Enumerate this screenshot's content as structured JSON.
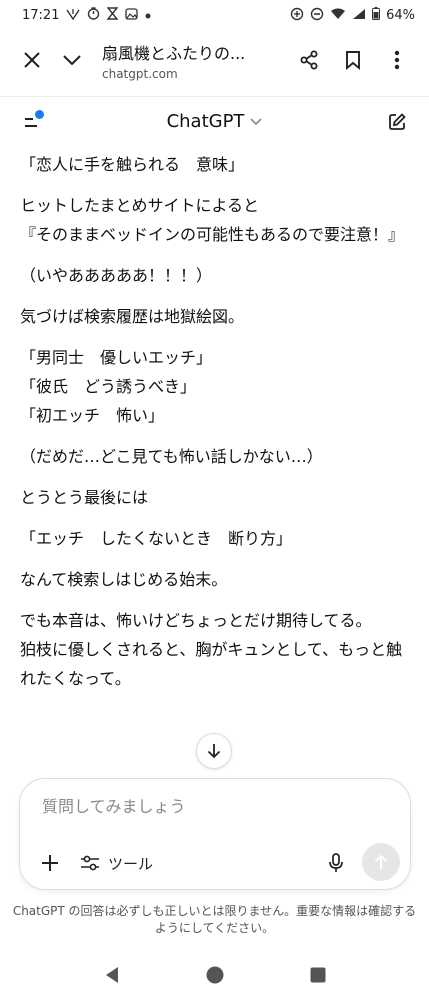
{
  "status_bar": {
    "time": "17:21",
    "battery": "64%"
  },
  "browser": {
    "title": "扇風機とふたりの...",
    "url": "chatgpt.com"
  },
  "app": {
    "title": "ChatGPT"
  },
  "messages": [
    "「恋人に手を触られる　意味」",
    "ヒットしたまとめサイトによると\n『そのままベッドインの可能性もあるので要注意！』",
    "（いやあああああ！！！）",
    "気づけば検索履歴は地獄絵図。",
    "「男同士　優しいエッチ」\n「彼氏　どう誘うべき」\n「初エッチ　怖い」",
    "（だめだ…どこ見ても怖い話しかない…）",
    "とうとう最後には",
    "「エッチ　したくないとき　断り方」",
    "なんて検索しはじめる始末。",
    "でも本音は、怖いけどちょっとだけ期待してる。\n狛枝に優しくされると、胸がキュンとして、もっと触れたくなって。"
  ],
  "composer": {
    "placeholder": "質問してみましょう",
    "tools_label": "ツール"
  },
  "disclaimer": "ChatGPT の回答は必ずしも正しいとは限りません。重要な情報は確認するようにしてください。",
  "colors": {
    "accent_dot": "#1a7cf5",
    "send_button_bg": "#e6e6e6"
  },
  "icons": {
    "close": "close-icon",
    "chevron": "chevron-down-icon",
    "share": "share-icon",
    "bookmark": "bookmark-icon",
    "more": "more-vert-icon",
    "menu": "menu-icon",
    "new_chat": "edit-icon",
    "scroll_down": "arrow-down-icon",
    "plus": "plus-icon",
    "tools": "tools-icon",
    "mic": "mic-icon",
    "send": "arrow-up-icon"
  }
}
